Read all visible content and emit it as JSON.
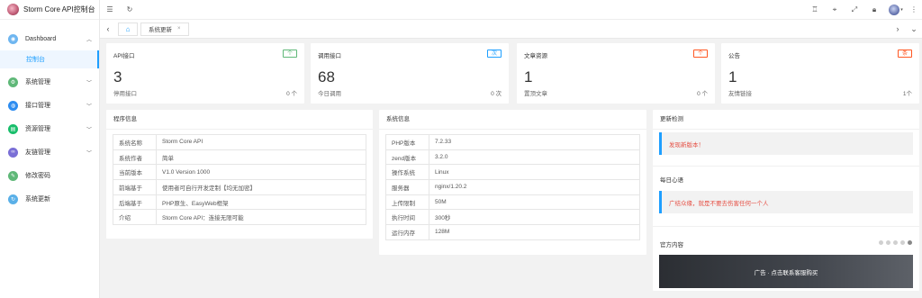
{
  "app": {
    "title": "Storm Core API控制台"
  },
  "sidebar": {
    "dashboard": {
      "label": "Dashboard",
      "sub": "控制台"
    },
    "items": [
      {
        "label": "系统管理",
        "icon": "settings-icon",
        "color": "#5fb878"
      },
      {
        "label": "接口管理",
        "icon": "api-icon",
        "color": "#2d8cf0"
      },
      {
        "label": "资源管理",
        "icon": "resource-icon",
        "color": "#19be6b"
      },
      {
        "label": "友链管理",
        "icon": "link-icon",
        "color": "#7a6fd6"
      },
      {
        "label": "修改密码",
        "icon": "password-icon",
        "color": "#5fb878"
      },
      {
        "label": "系统更新",
        "icon": "update-icon",
        "color": "#5ab0e8"
      }
    ]
  },
  "tabs": {
    "active": "系统更新",
    "close": "×"
  },
  "stats": [
    {
      "title": "API接口",
      "badge": "个",
      "badge_color": "#5fb878",
      "value": "3",
      "sub": "停用接口",
      "sub_value": "0 个"
    },
    {
      "title": "调用接口",
      "badge": "次",
      "badge_color": "#1e9fff",
      "value": "68",
      "sub": "今日调用",
      "sub_value": "0 次"
    },
    {
      "title": "文章资源",
      "badge": "个",
      "badge_color": "#ff5722",
      "value": "1",
      "sub": "置顶文章",
      "sub_value": "0 个"
    },
    {
      "title": "公告",
      "badge": "条",
      "badge_color": "#ff5722",
      "value": "1",
      "sub": "友情链接",
      "sub_value": "1个"
    }
  ],
  "program_info": {
    "title": "程序信息",
    "rows": [
      {
        "k": "系统名称",
        "v": "Storm Core API"
      },
      {
        "k": "系统作者",
        "v": "简单"
      },
      {
        "k": "当前版本",
        "v": "V1.0 Version 1000"
      },
      {
        "k": "前端基于",
        "v": "使用者可自行开发定制【均无加密】"
      },
      {
        "k": "后端基于",
        "v": "PHP原生、EasyWeb框架"
      },
      {
        "k": "介绍",
        "v": "Storm Core API：连接无限可能"
      }
    ]
  },
  "system_info": {
    "title": "系统信息",
    "rows": [
      {
        "k": "PHP版本",
        "v": "7.2.33"
      },
      {
        "k": "zend版本",
        "v": "3.2.0"
      },
      {
        "k": "操作系统",
        "v": "Linux"
      },
      {
        "k": "服务器",
        "v": "nginx/1.20.2"
      },
      {
        "k": "上传限制",
        "v": "50M"
      },
      {
        "k": "执行时间",
        "v": "300秒"
      },
      {
        "k": "运行内存",
        "v": "128M"
      }
    ]
  },
  "right": {
    "update_title": "更新检测",
    "update_msg": "发现新版本！",
    "daily_title": "每日心语",
    "daily_msg": "广结众缘，就是不要去伤害任何一个人",
    "official_title": "官方内容",
    "ad_text": "广告 · 点击联系客服购买"
  }
}
